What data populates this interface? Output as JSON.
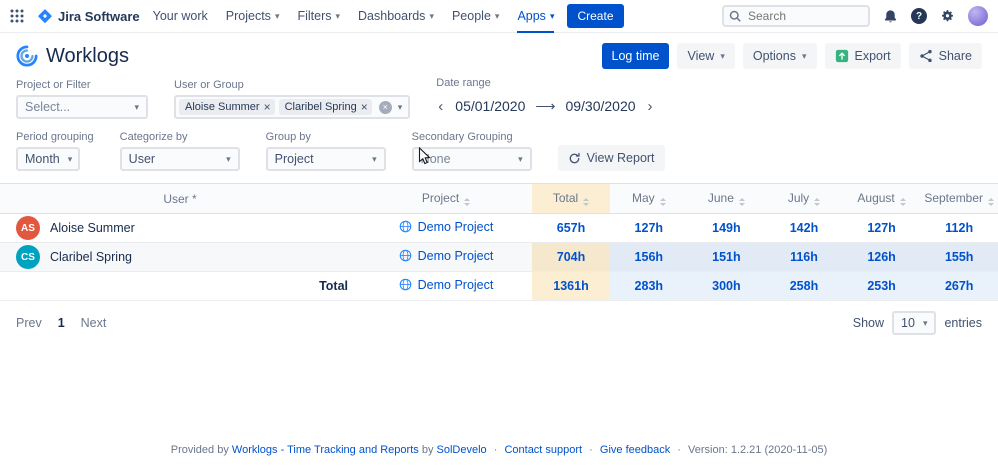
{
  "topnav": {
    "brand": "Jira Software",
    "items": [
      {
        "label": "Your work"
      },
      {
        "label": "Projects"
      },
      {
        "label": "Filters"
      },
      {
        "label": "Dashboards"
      },
      {
        "label": "People"
      },
      {
        "label": "Apps"
      }
    ],
    "create_label": "Create",
    "search": {
      "placeholder": "Search"
    }
  },
  "header": {
    "title": "Worklogs",
    "buttons": {
      "log_time": "Log time",
      "view": "View",
      "options": "Options",
      "export": "Export",
      "share": "Share"
    }
  },
  "filters": {
    "project_or_filter": {
      "label": "Project or Filter",
      "placeholder": "Select..."
    },
    "user_or_group": {
      "label": "User or Group",
      "tags": [
        {
          "label": "Aloise Summer"
        },
        {
          "label": "Claribel Spring"
        }
      ]
    },
    "date_range": {
      "label": "Date range",
      "start": "05/01/2020",
      "end": "09/30/2020"
    },
    "period_grouping": {
      "label": "Period grouping",
      "value": "Month"
    },
    "categorize_by": {
      "label": "Categorize by",
      "value": "User"
    },
    "group_by": {
      "label": "Group by",
      "value": "Project"
    },
    "secondary_grouping": {
      "label": "Secondary Grouping",
      "value": "None"
    },
    "view_report_label": "View Report"
  },
  "table": {
    "header": {
      "user": "User",
      "user_marker": "*",
      "project": "Project",
      "total": "Total",
      "months": [
        "May",
        "June",
        "July",
        "August",
        "September"
      ]
    },
    "rows": [
      {
        "initials": "AS",
        "avatar_color": "#E2583E",
        "user": "Aloise Summer",
        "project": "Demo Project",
        "total": "657h",
        "months": [
          "127h",
          "149h",
          "142h",
          "127h",
          "112h"
        ]
      },
      {
        "initials": "CS",
        "avatar_color": "#00A3BF",
        "user": "Claribel Spring",
        "project": "Demo Project",
        "total": "704h",
        "months": [
          "156h",
          "151h",
          "116h",
          "126h",
          "155h"
        ]
      }
    ],
    "total_row": {
      "label": "Total",
      "project": "Demo Project",
      "total": "1361h",
      "months": [
        "283h",
        "300h",
        "258h",
        "253h",
        "267h"
      ]
    }
  },
  "pagination": {
    "prev": "Prev",
    "current_page": "1",
    "next": "Next",
    "show": "Show",
    "page_size": "10",
    "entries": "entries"
  },
  "footer": {
    "provided_by": "Provided by",
    "worklogs_link": "Worklogs - Time Tracking and Reports",
    "by": "by",
    "vendor_link": "SolDevelo",
    "contact_link": "Contact support",
    "feedback_link": "Give feedback",
    "version": "Version: 1.2.21 (2020-11-05)"
  },
  "colors": {
    "brand_blue": "#0052CC",
    "total_column_bg": "#FBEED3",
    "month_column_bg": "#E9F1FA",
    "avatar_aloise": "#E2583E",
    "avatar_claribel": "#00A3BF",
    "export_icon_green": "#36B37E"
  }
}
